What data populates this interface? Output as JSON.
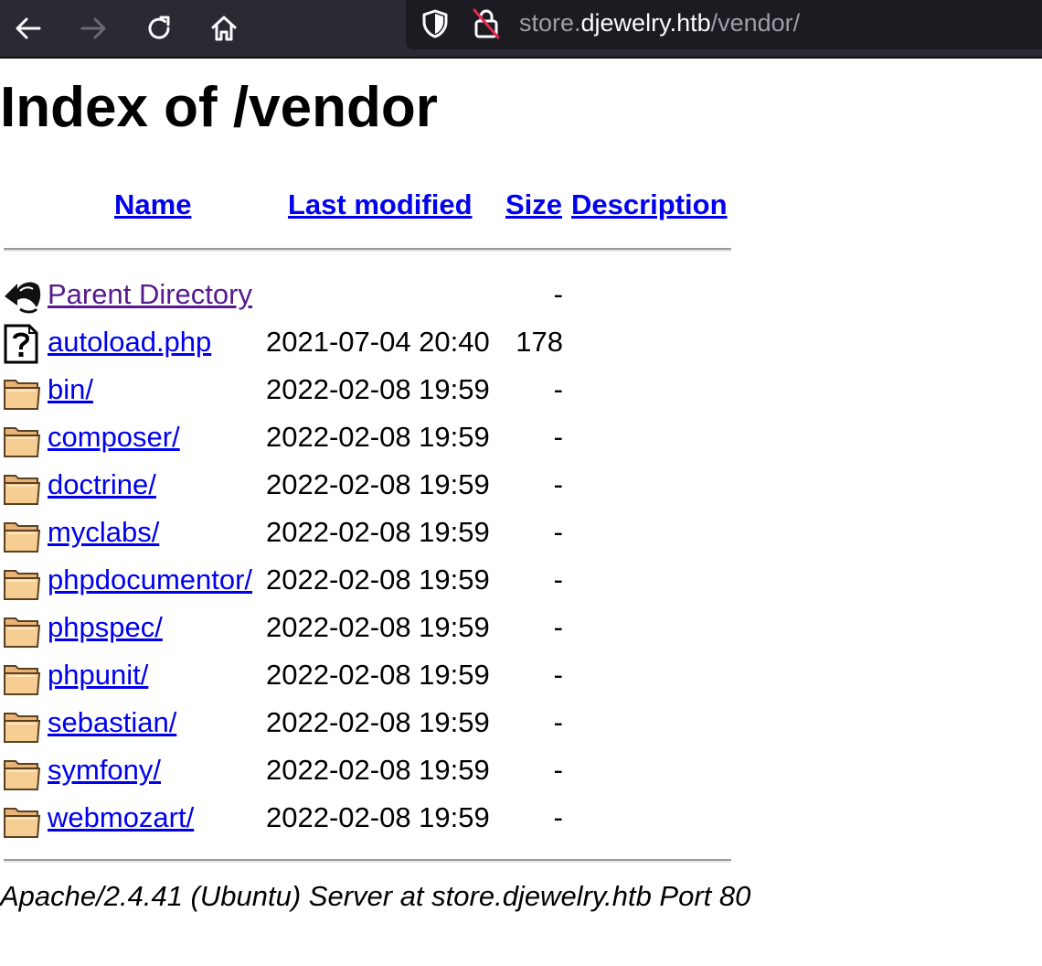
{
  "browser": {
    "back_icon": "arrow-left-icon",
    "forward_icon": "arrow-right-icon",
    "reload_icon": "reload-icon",
    "home_icon": "home-icon",
    "tracking_icon": "shield-icon",
    "security_icon": "insecure-lock-icon",
    "url_scheme_host_prefix": "store.",
    "url_host": "djewelry.htb",
    "url_path": "/vendor/"
  },
  "page": {
    "title": "Index of /vendor",
    "columns": {
      "name": "Name",
      "last_modified": "Last modified",
      "size": "Size",
      "description": "Description"
    },
    "rows": [
      {
        "icon": "back-icon",
        "name": "Parent Directory",
        "modified": "",
        "size": "-",
        "visited": true
      },
      {
        "icon": "unknown-file-icon",
        "name": "autoload.php",
        "modified": "2021-07-04 20:40",
        "size": "178",
        "visited": false
      },
      {
        "icon": "folder-icon",
        "name": "bin/",
        "modified": "2022-02-08 19:59",
        "size": "-",
        "visited": false
      },
      {
        "icon": "folder-icon",
        "name": "composer/",
        "modified": "2022-02-08 19:59",
        "size": "-",
        "visited": false
      },
      {
        "icon": "folder-icon",
        "name": "doctrine/",
        "modified": "2022-02-08 19:59",
        "size": "-",
        "visited": false
      },
      {
        "icon": "folder-icon",
        "name": "myclabs/",
        "modified": "2022-02-08 19:59",
        "size": "-",
        "visited": false
      },
      {
        "icon": "folder-icon",
        "name": "phpdocumentor/",
        "modified": "2022-02-08 19:59",
        "size": "-",
        "visited": false
      },
      {
        "icon": "folder-icon",
        "name": "phpspec/",
        "modified": "2022-02-08 19:59",
        "size": "-",
        "visited": false
      },
      {
        "icon": "folder-icon",
        "name": "phpunit/",
        "modified": "2022-02-08 19:59",
        "size": "-",
        "visited": false
      },
      {
        "icon": "folder-icon",
        "name": "sebastian/",
        "modified": "2022-02-08 19:59",
        "size": "-",
        "visited": false
      },
      {
        "icon": "folder-icon",
        "name": "symfony/",
        "modified": "2022-02-08 19:59",
        "size": "-",
        "visited": false
      },
      {
        "icon": "folder-icon",
        "name": "webmozart/",
        "modified": "2022-02-08 19:59",
        "size": "-",
        "visited": false
      }
    ],
    "footer": "Apache/2.4.41 (Ubuntu) Server at store.djewelry.htb Port 80"
  },
  "colors": {
    "link": "#0000ee",
    "visited_link": "#551a8b",
    "toolbar_bg": "#2b2a33",
    "urlbar_bg": "#1c1b22"
  }
}
